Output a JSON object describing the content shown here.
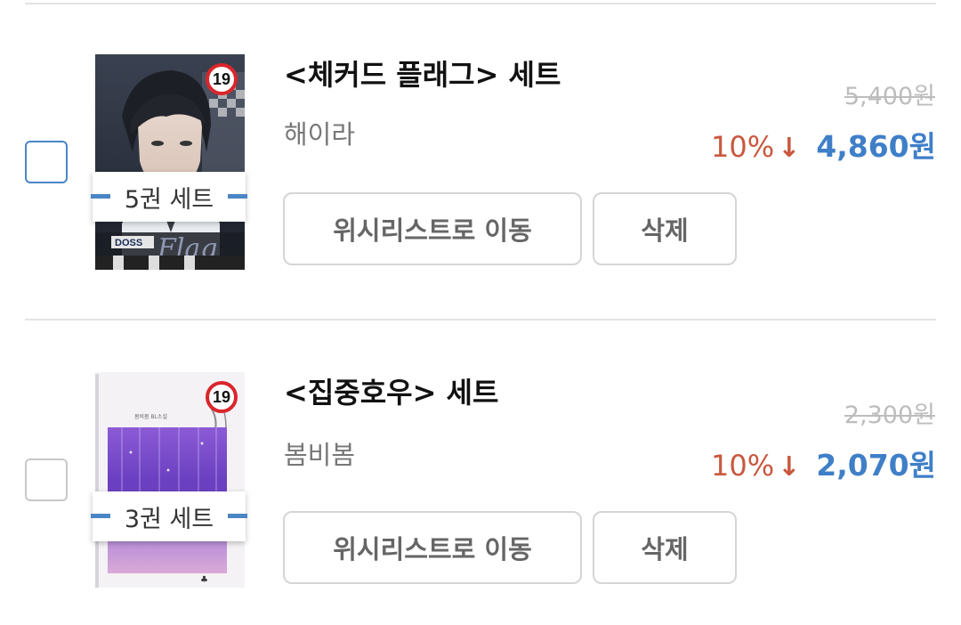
{
  "items": [
    {
      "title": "<체커드 플래그> 세트",
      "author": "해이라",
      "original_price": "5,400원",
      "discount": "10%",
      "sale_price": "4,860원",
      "volume_tag": "5권 세트",
      "age_rating": "19",
      "checked": true,
      "wishlist_button": "위시리스트로 이동",
      "delete_button": "삭제"
    },
    {
      "title": "<집중호우> 세트",
      "author": "봄비봄",
      "original_price": "2,300원",
      "discount": "10%",
      "sale_price": "2,070원",
      "volume_tag": "3권 세트",
      "age_rating": "19",
      "checked": false,
      "wishlist_button": "위시리스트로 이동",
      "delete_button": "삭제"
    }
  ],
  "icons": {
    "discount_arrow": "down-arrow-icon"
  },
  "colors": {
    "discount": "#c9583f",
    "sale_price": "#3f7fc8",
    "checkbox_active": "#4a86c5"
  }
}
